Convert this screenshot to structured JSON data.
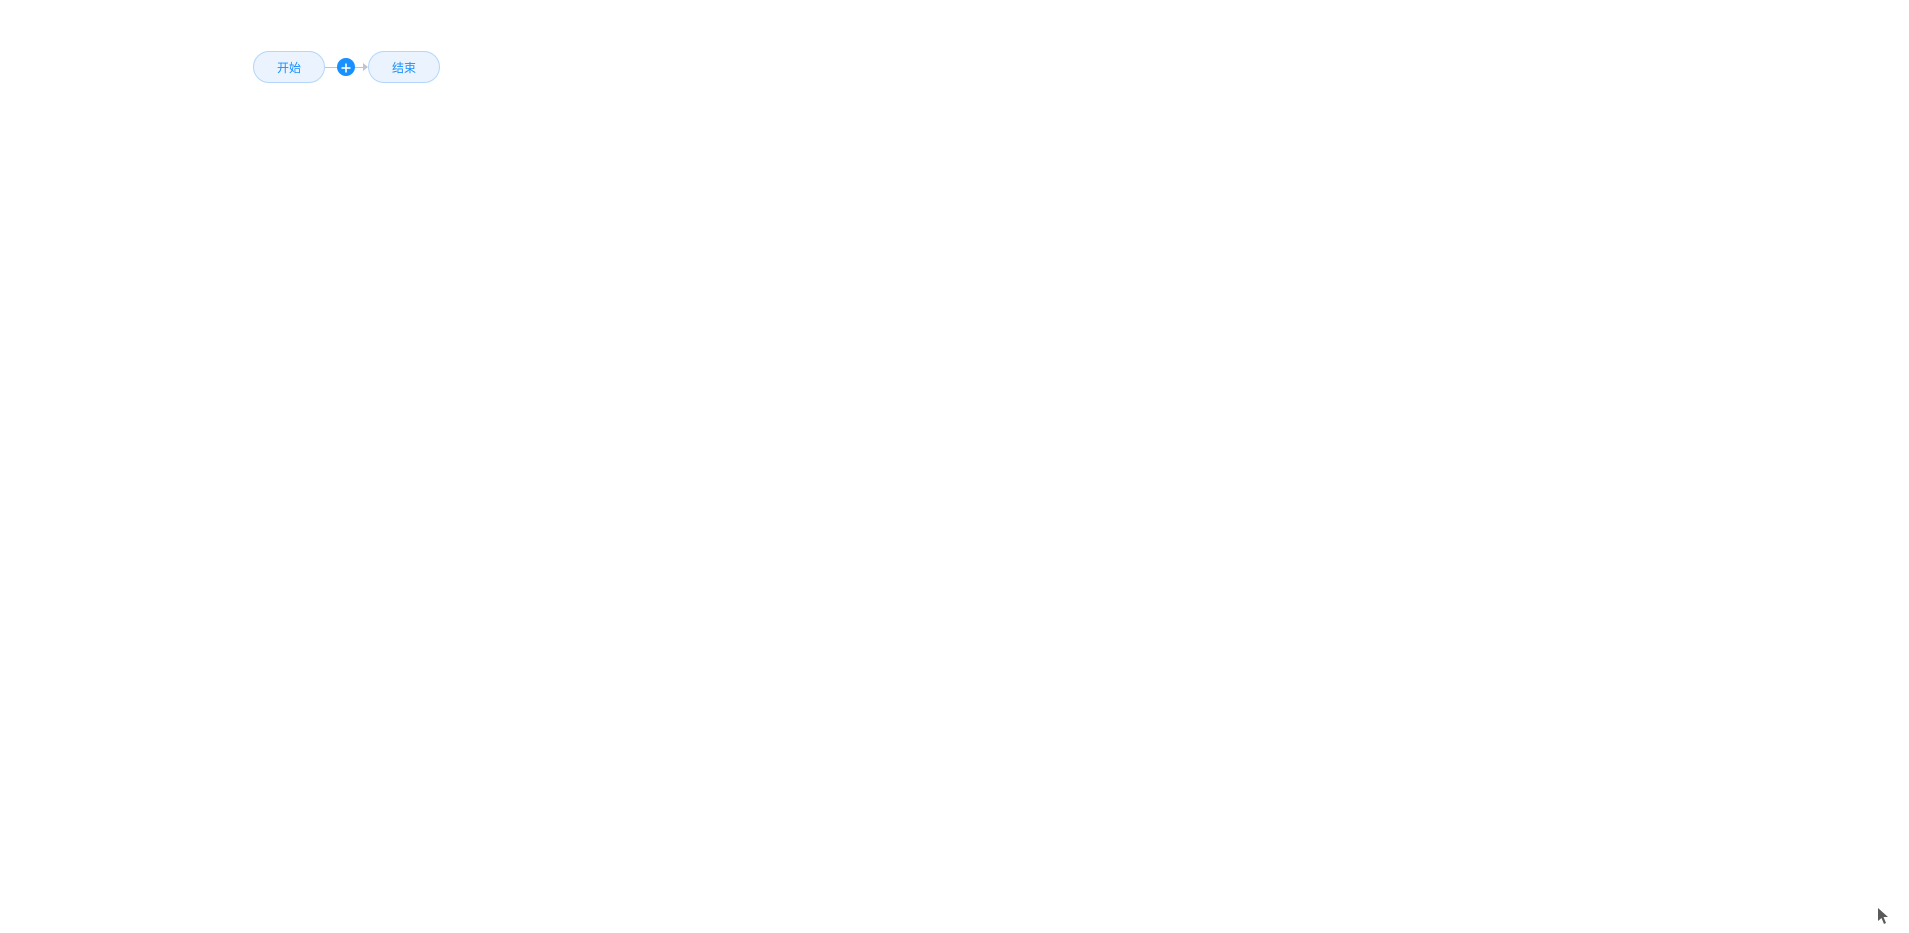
{
  "flow": {
    "nodes": {
      "start": {
        "label": "开始"
      },
      "end": {
        "label": "结束"
      }
    },
    "add_icon": "plus-icon"
  }
}
